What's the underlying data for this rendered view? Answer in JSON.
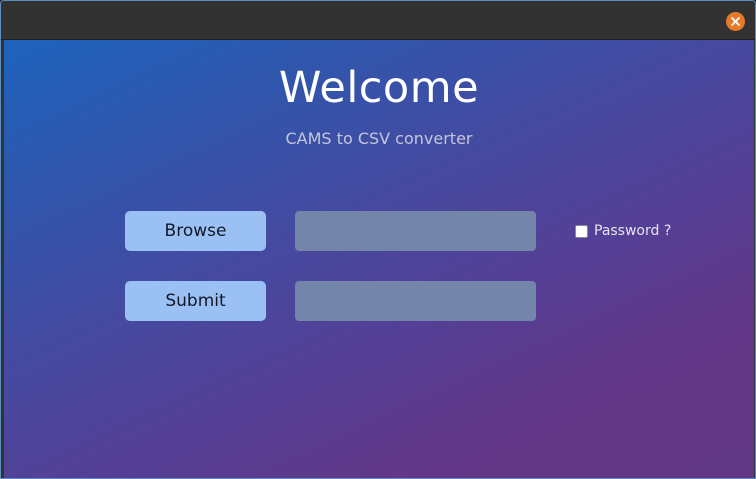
{
  "window": {
    "close_icon": "close-icon",
    "close_color": "#e8792a"
  },
  "main": {
    "title": "Welcome",
    "subtitle": "CAMS to CSV converter",
    "browse_label": "Browse",
    "submit_label": "Submit",
    "path_value": "",
    "password_value": "",
    "password_checkbox_label": "Password ?",
    "password_checkbox_checked": false
  },
  "colors": {
    "button_bg": "#9bc0f4",
    "field_bg": "#7385a8",
    "gradient_start": "#1d63bd",
    "gradient_end": "#633787"
  }
}
